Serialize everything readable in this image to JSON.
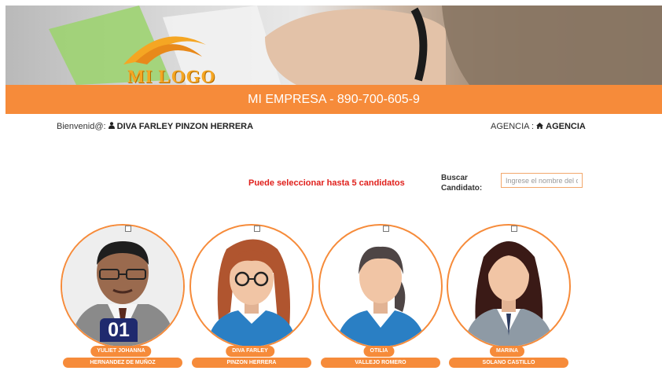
{
  "header": {
    "logo_text": "MI LOGO",
    "company": "MI EMPRESA - 890-700-605-9"
  },
  "user": {
    "welcome_label": "Bienvenid@:",
    "name": "DIVA FARLEY PINZON HERRERA",
    "agency_label": "AGENCIA :",
    "agency": "AGENCIA"
  },
  "selection": {
    "notice": "Puede seleccionar hasta 5 candidatos"
  },
  "search": {
    "label": "Buscar Candidato:",
    "placeholder": "Ingrese el nombre del c",
    "value": ""
  },
  "candidates": [
    {
      "first": "YULIET JOHANNA",
      "last": "HERNANDEZ DE MUÑOZ",
      "number": "01",
      "checked": false
    },
    {
      "first": "DIVA FARLEY",
      "last": "PINZON HERRERA",
      "checked": false
    },
    {
      "first": "OTILIA",
      "last": "VALLEJO ROMERO",
      "checked": false
    },
    {
      "first": "MARINA",
      "last": "SOLANO CASTILLO",
      "checked": false
    }
  ],
  "colors": {
    "accent": "#f68b3a",
    "alert": "#e0201c",
    "badge": "#1f2a6e"
  }
}
